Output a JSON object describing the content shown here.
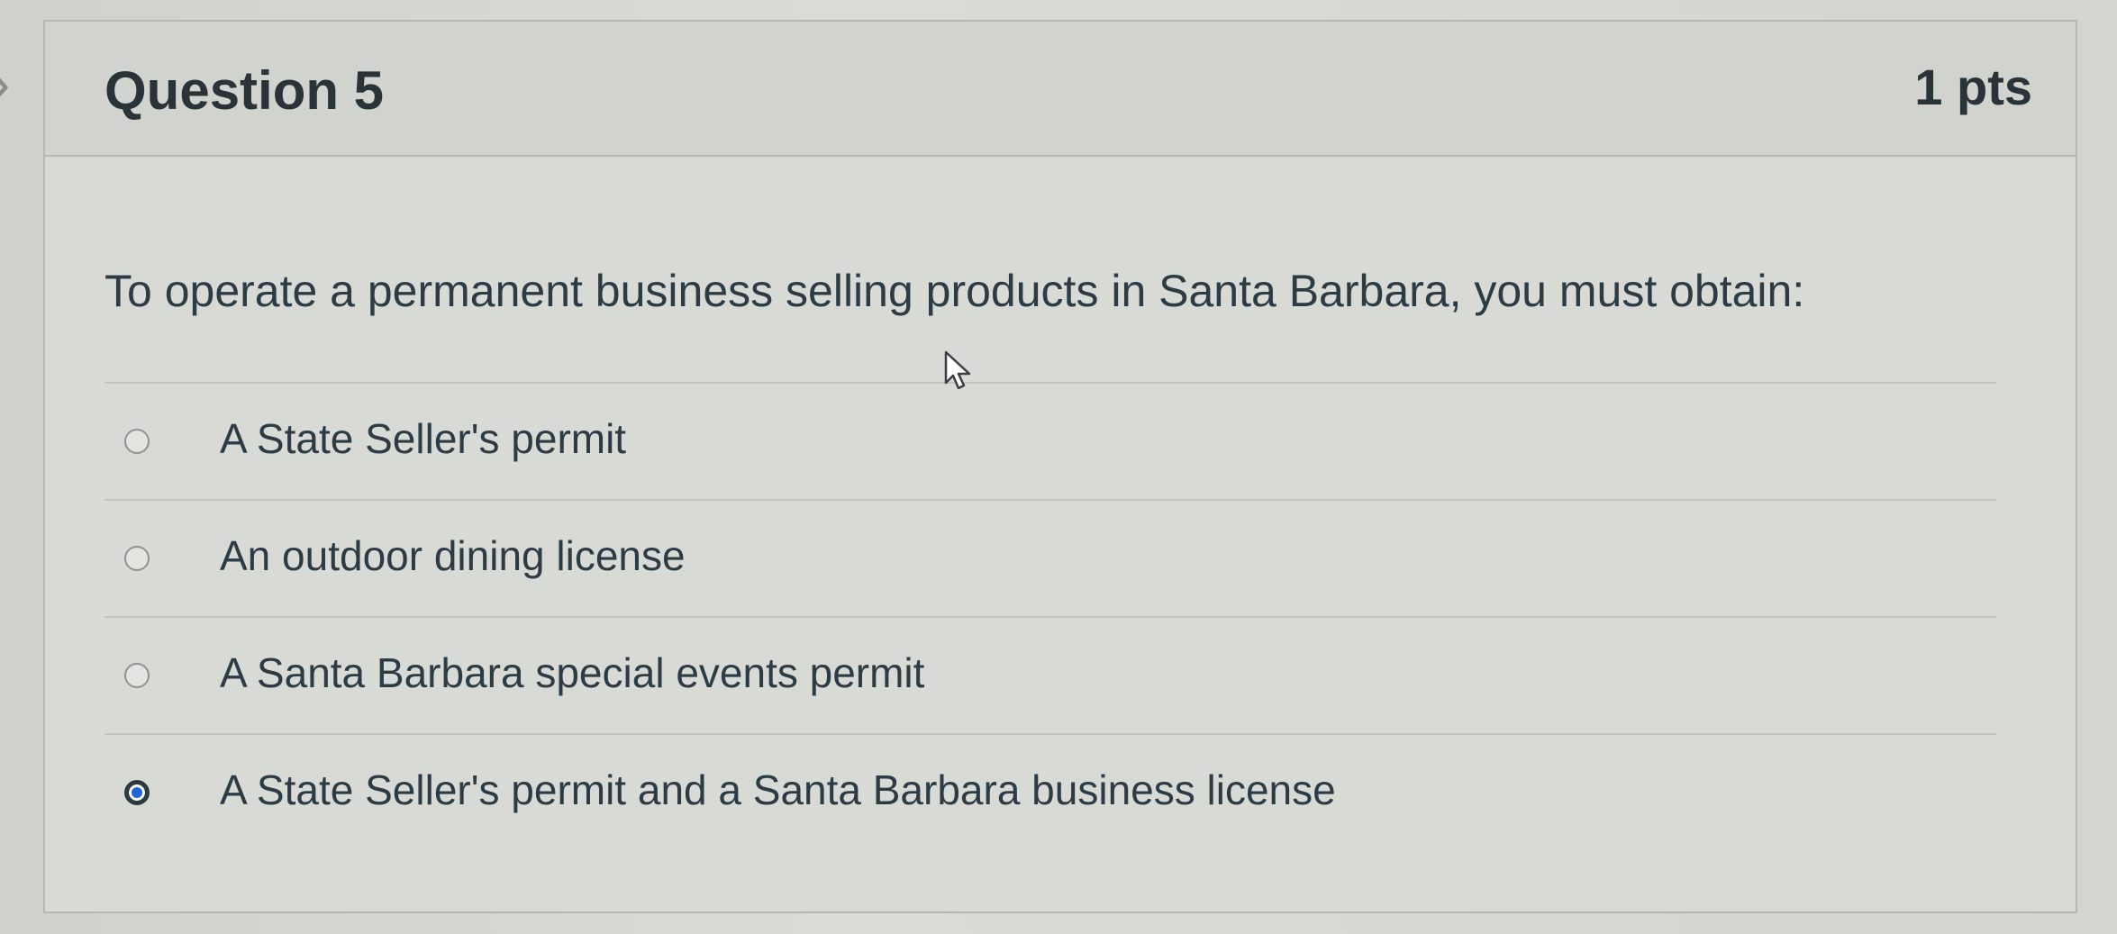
{
  "question": {
    "title": "Question 5",
    "points": "1 pts",
    "text": "To operate a permanent business selling products in Santa Barbara, you must obtain:"
  },
  "answers": [
    {
      "label": "A State Seller's permit",
      "selected": false
    },
    {
      "label": "An outdoor dining license",
      "selected": false
    },
    {
      "label": "A Santa Barbara special events permit",
      "selected": false
    },
    {
      "label": "A State Seller's permit and a Santa Barbara business license",
      "selected": true
    }
  ],
  "colors": {
    "selected_radio": "#1a66d6",
    "text": "#2d3b45"
  }
}
